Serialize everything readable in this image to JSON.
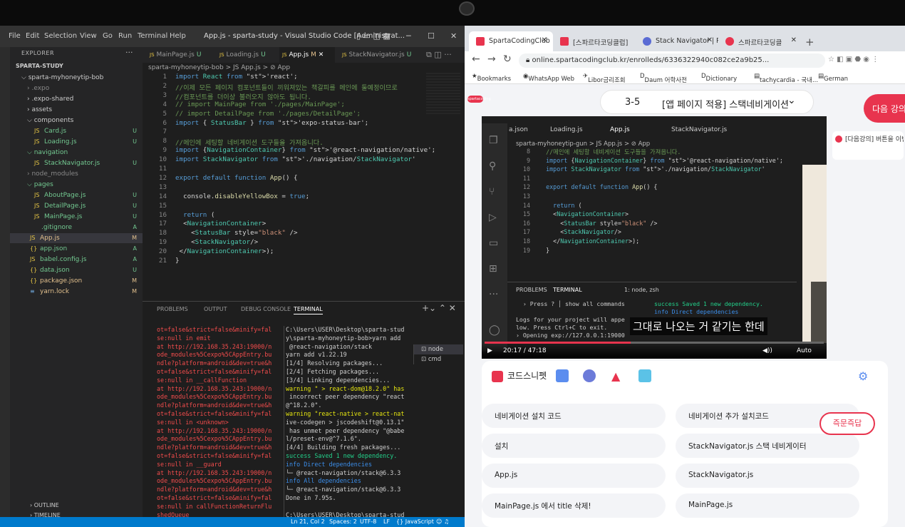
{
  "vscode": {
    "menu": [
      "File",
      "Edit",
      "Selection",
      "View",
      "Go",
      "Run",
      "Terminal",
      "Help"
    ],
    "title": "App.js - sparta-study - Visual Studio Code [Administrat...",
    "explorer": {
      "header": "EXPLORER",
      "root": "SPARTA-STUDY",
      "items": [
        {
          "name": "sparta-myhoneytip-bob",
          "status": ""
        },
        {
          "name": ".expo",
          "status": ""
        },
        {
          "name": ".expo-shared",
          "status": ""
        },
        {
          "name": "assets",
          "status": ""
        },
        {
          "name": "components",
          "status": ""
        },
        {
          "name": "Card.js",
          "status": "U"
        },
        {
          "name": "Loading.js",
          "status": "U"
        },
        {
          "name": "navigation",
          "status": ""
        },
        {
          "name": "StackNavigator.js",
          "status": "U"
        },
        {
          "name": "node_modules",
          "status": ""
        },
        {
          "name": "pages",
          "status": ""
        },
        {
          "name": "AboutPage.js",
          "status": "U"
        },
        {
          "name": "DetailPage.js",
          "status": "U"
        },
        {
          "name": "MainPage.js",
          "status": "U"
        },
        {
          "name": ".gitignore",
          "status": "A"
        },
        {
          "name": "App.js",
          "status": "M"
        },
        {
          "name": "app.json",
          "status": "A"
        },
        {
          "name": "babel.config.js",
          "status": "A"
        },
        {
          "name": "data.json",
          "status": "U"
        },
        {
          "name": "package.json",
          "status": "M"
        },
        {
          "name": "yarn.lock",
          "status": "M"
        }
      ],
      "outline": "OUTLINE",
      "timeline": "TIMELINE"
    },
    "tabs": [
      {
        "label": "MainPage.js",
        "status": "U"
      },
      {
        "label": "Loading.js",
        "status": "U"
      },
      {
        "label": "App.js",
        "status": "M"
      },
      {
        "label": "StackNavigator.js",
        "status": "U"
      }
    ],
    "breadcrumb": "sparta-myhoneytip-bob  >  JS App.js  >  ⊘ App",
    "code_lines": [
      "import React from 'react';",
      "//이제 모든 페이지 컴포넌트들이 끼워져있는 책갈피를 메인에 둘예정이므로",
      "//컴포넌트를 더이상 불러오지 않아도 됩니다.",
      "// import MainPage from './pages/MainPage';",
      "// import DetailPage from './pages/DetailPage';",
      "import { StatusBar } from 'expo-status-bar';",
      "",
      "//메인에 세팅할 네비게이션 도구들을 가져옵니다.",
      "import {NavigationContainer} from '@react-navigation/native';",
      "import StackNavigator from './navigation/StackNavigator'",
      "",
      "export default function App() {",
      "",
      "  console.disableYellowBox = true;",
      "",
      "  return (",
      "  <NavigationContainer>",
      "    <StatusBar style=\"black\" />",
      "    <StackNavigator/>",
      " </NavigationContainer>);",
      "}"
    ],
    "panel_tabs": [
      "PROBLEMS",
      "OUTPUT",
      "DEBUG CONSOLE",
      "TERMINAL"
    ],
    "terminal_left": "ot=false&strict=false&minify=fal\nse:null in emit\nat http://192.168.35.243:19000/n\node_modules%5Cexpo%5CAppEntry.bu\nndle?platform=android&dev=true&h\not=false&strict=false&minify=fal\nse:null in __callFunction\nat http://192.168.35.243:19000/n\node_modules%5Cexpo%5CAppEntry.bu\nndle?platform=android&dev=true&h\not=false&strict=false&minify=fal\nse:null in <unknown>\nat http://192.168.35.243:19000/n\node_modules%5Cexpo%5CAppEntry.bu\nndle?platform=android&dev=true&h\not=false&strict=false&minify=fal\nse:null in __guard\nat http://192.168.35.243:19000/n\node_modules%5Cexpo%5CAppEntry.bu\nndle?platform=android&dev=true&h\not=false&strict=false&minify=fal\nse:null in callFunctionReturnFlu\nshedQueue\n[]",
    "terminal_mid": [
      {
        "t": "C:\\Users\\USER\\Desktop\\sparta-stud",
        "c": ""
      },
      {
        "t": "y\\sparta-myhoneytip-bob>yarn add",
        "c": ""
      },
      {
        "t": " @react-navigation/stack",
        "c": ""
      },
      {
        "t": "yarn add v1.22.19",
        "c": ""
      },
      {
        "t": "[1/4] Resolving packages...",
        "c": ""
      },
      {
        "t": "[2/4] Fetching packages...",
        "c": ""
      },
      {
        "t": "[3/4] Linking dependencies...",
        "c": ""
      },
      {
        "t": "warning \" > react-dom@18.2.0\" has",
        "c": "yw"
      },
      {
        "t": " incorrect peer dependency \"react",
        "c": ""
      },
      {
        "t": "@^18.2.0\".",
        "c": ""
      },
      {
        "t": "warning \"react-native > react-nat",
        "c": "yw"
      },
      {
        "t": "ive-codegen > jscodeshift@0.13.1\"",
        "c": ""
      },
      {
        "t": " has unmet peer dependency \"@babe",
        "c": ""
      },
      {
        "t": "l/preset-env@^7.1.6\".",
        "c": ""
      },
      {
        "t": "[4/4] Building fresh packages...",
        "c": ""
      },
      {
        "t": "success Saved 1 new dependency.",
        "c": "gn"
      },
      {
        "t": "info Direct dependencies",
        "c": "bl"
      },
      {
        "t": "└─ @react-navigation/stack@6.3.3",
        "c": ""
      },
      {
        "t": "info All dependencies",
        "c": "bl"
      },
      {
        "t": "└─ @react-navigation/stack@6.3.3",
        "c": ""
      },
      {
        "t": "Done in 7.95s.",
        "c": ""
      },
      {
        "t": "",
        "c": ""
      },
      {
        "t": "C:\\Users\\USER\\Desktop\\sparta-stud",
        "c": ""
      },
      {
        "t": "y\\sparta-myhoneytip-bob>[]",
        "c": ""
      }
    ],
    "terminal_list": [
      "node",
      "cmd"
    ],
    "status": {
      "pos": "Ln 21, Col 2",
      "spaces": "Spaces: 2",
      "enc": "UTF-8",
      "eol": "LF",
      "lang": "{} JavaScript"
    }
  },
  "chrome": {
    "tabs": [
      {
        "label": "SpartaCodingClub",
        "color": "#e8344e"
      },
      {
        "label": "[스파르타코딩클럽]",
        "color": "#e8344e"
      },
      {
        "label": "Stack Navigator | R",
        "color": "#5a6bd4"
      },
      {
        "label": "스파르타코딩클",
        "color": "#e8344e"
      }
    ],
    "new_tab": "+",
    "url": "online.spartacodingclub.kr/enrolleds/6336322940c082ce2a9b25...",
    "bookmarks": [
      "Bookmarks",
      "WhatsApp Web",
      "Libor금리조회",
      "Daum 어학사전",
      "Dictionary",
      "tachycardia - 국내...",
      "German"
    ],
    "page": {
      "logo": "spartacoding",
      "lesson_num": "3-5",
      "lesson_title": "[앱 페이지 적용] 스택네비게이션",
      "next_button": "다음 강의",
      "notify": "[다음강의] 버튼을 이번 강의 수강이 완",
      "video": {
        "tabs": [
          "a.json",
          "Loading.js",
          "App.js",
          "StackNavigator.js"
        ],
        "crumb": "sparta-myhoneytip-gun > JS App.js > ⊘ App",
        "line_start": 8,
        "code_lines": [
          "  //메인에 세팅할 네비게이션 도구들을 가져옵니다.",
          "  import {NavigationContainer} from '@react-navigation/native';",
          "  import StackNavigator from './navigation/StackNavigator'",
          "",
          "  export default function App() {",
          "",
          "    return (",
          "    <NavigationContainer>",
          "      <StatusBar style=\"black\" />",
          "      <StackNavigator/>",
          "    </NavigationContainer>);",
          "  }"
        ],
        "panel_tabs": [
          "PROBLEMS",
          "TERMINAL"
        ],
        "term_select": "1: node, zsh",
        "terminal": "  › Press ? │ show all commands\n\nLogs for your project will appe\nlow. Press Ctrl+C to exit.\n› Opening exp://127.0.0.1:19000",
        "terminal2": "success Saved 1 new dependency.\ninfo Direct dependencies",
        "subtitle": "그대로 나오는 거 같기는 한데",
        "time": "20:17 / 47:18",
        "progress": 0.43,
        "quality": "Auto"
      },
      "snippets": {
        "title": "코드스니펫",
        "left": [
          "네비게이션 설치 코드",
          "설치",
          "App.js",
          "MainPage.js 에서 title 삭제!"
        ],
        "right": [
          "네비게이션 추가 설치코드",
          "StackNavigator.js 스택 네비게이터",
          "StackNavigator.js",
          "MainPage.js"
        ],
        "quiz_button": "즉문즉답"
      }
    }
  }
}
